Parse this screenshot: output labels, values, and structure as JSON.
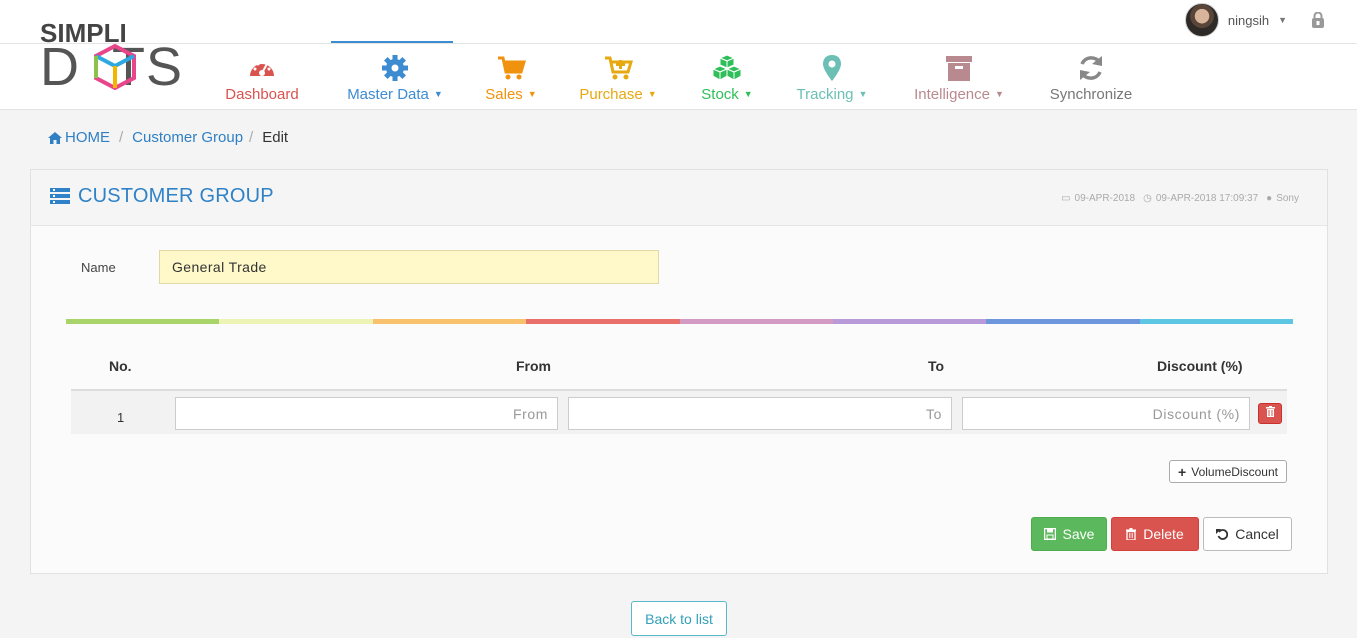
{
  "user": {
    "name": "ningsih"
  },
  "logo": {
    "top": "SIMPLI",
    "bottom": "DOTS"
  },
  "nav": {
    "items": [
      {
        "label": "Dashboard",
        "icon": "dashboard-gauge-icon",
        "color": "#d9534f",
        "dropdown": false
      },
      {
        "label": "Master Data",
        "icon": "gear-icon",
        "color": "#3d8bd1",
        "dropdown": true
      },
      {
        "label": "Sales",
        "icon": "cart-icon",
        "color": "#f0920d",
        "dropdown": true
      },
      {
        "label": "Purchase",
        "icon": "cart-plus-icon",
        "color": "#e6a910",
        "dropdown": true
      },
      {
        "label": "Stock",
        "icon": "cubes-icon",
        "color": "#2ebf58",
        "dropdown": true
      },
      {
        "label": "Tracking",
        "icon": "map-marker-icon",
        "color": "#6cbfb4",
        "dropdown": true
      },
      {
        "label": "Intelligence",
        "icon": "archive-icon",
        "color": "#b88a8f",
        "dropdown": true
      },
      {
        "label": "Synchronize",
        "icon": "refresh-icon",
        "color": "#777777",
        "dropdown": false
      }
    ],
    "active": "Master Data"
  },
  "breadcrumb": {
    "home": "HOME",
    "section": "Customer Group",
    "current": "Edit",
    "separator": "/"
  },
  "panel": {
    "title": "CUSTOMER GROUP",
    "created_date": "09-APR-2018",
    "modified_datetime": "09-APR-2018 17:09:37",
    "user": "Sony"
  },
  "form": {
    "name_label": "Name",
    "name_value": "General Trade"
  },
  "rainbow_colors": [
    "#a9d46a",
    "#edf2b5",
    "#f7c26b",
    "#e9706a",
    "#d39bc3",
    "#b99ad9",
    "#6e96dc",
    "#5cc6e3"
  ],
  "table": {
    "headers": {
      "no": "No.",
      "from": "From",
      "to": "To",
      "discount": "Discount (%)"
    },
    "rows": [
      {
        "no": "1",
        "from_placeholder": "From",
        "to_placeholder": "To",
        "discount_placeholder": "Discount (%)"
      }
    ]
  },
  "buttons": {
    "add_volume": "VolumeDiscount",
    "save": "Save",
    "delete": "Delete",
    "cancel": "Cancel",
    "back": "Back to list"
  }
}
